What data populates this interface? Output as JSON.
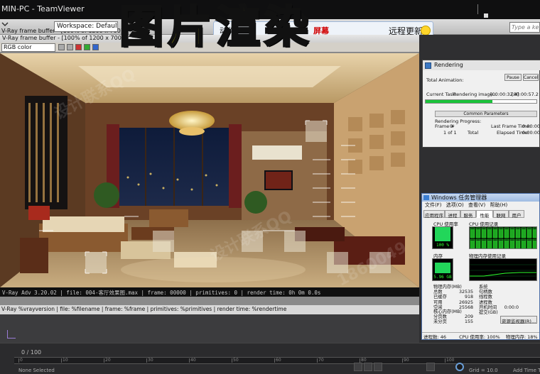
{
  "teamviewer": {
    "title": "MIN-PC - TeamViewer"
  },
  "banner": {
    "text": "图片渲染"
  },
  "max_toolbar": {
    "vfb_title": "V-Ray frame buffer - [100% of 1200 x 700]",
    "workspace_label": "Workspace: Default",
    "search_placeholder": "Type a keyword"
  },
  "chat": {
    "action": "动作",
    "screen_label": "屏幕",
    "remote_update": "远程更新"
  },
  "vfb": {
    "channel": "RGB color",
    "status_line": "V-Ray Adv 3.20.02 | file: 004-客厅效果图.max | frame: 00000 | primitives: 0 | render time: 0h 0m 0.0s"
  },
  "max": {
    "prompt_line": "V-Ray %vrayversion | file: %filename | frame: %frame | primitives: %primitives | render time: %rendertime",
    "frame_counter": "0 / 100",
    "status_selection": "None Selected",
    "grid_label": "Grid = 10.0",
    "add_key": "Add Time Tag",
    "timeline_ticks": [
      "0",
      "10",
      "20",
      "30",
      "40",
      "50",
      "60",
      "70",
      "80",
      "90",
      "100"
    ]
  },
  "rendering": {
    "title": "Rendering",
    "total_animation": "Total Animation:",
    "pause": "Pause",
    "cancel": "Cancel",
    "current_task_label": "Current Task:",
    "current_task_value": "Rendering image...",
    "elapsed_current": "[00:00:32.4]",
    "estimate_current": "[00:00:57.2 est]",
    "progress": 0.6,
    "section_title": "Common Parameters",
    "rendering_progress": "Rendering Progress:",
    "frame_label": "Frame #",
    "frame_value": "0",
    "of_label": "1 of 1",
    "total_label": "Total",
    "last_frame_time_label": "Last Frame Time:",
    "last_frame_time_value": "0:00:00",
    "elapsed_time_label": "Elapsed Time:",
    "elapsed_time_value": "0:00:00"
  },
  "task_manager": {
    "title": "Windows 任务管理器",
    "menu": [
      "文件(F)",
      "选项(O)",
      "查看(V)",
      "帮助(H)"
    ],
    "tabs": [
      "应用程序",
      "进程",
      "服务",
      "性能",
      "联网",
      "用户"
    ],
    "active_tab": 3,
    "cpu_usage_label": "CPU 使用率",
    "cpu_usage_value": "100 %",
    "cpu_usage": 1.0,
    "cpu_history_label": "CPU 使用记录",
    "memory_label": "内存",
    "memory_value": "5.96 GB",
    "memory_usage": 0.75,
    "memory_history_label": "物理内存使用记录",
    "phys_mem": {
      "title": "物理内存(MB)",
      "rows": [
        [
          "总数",
          "32535"
        ],
        [
          "已缓存",
          "918"
        ],
        [
          "可用",
          "26925"
        ],
        [
          "空闲",
          "25568"
        ]
      ]
    },
    "system": {
      "title": "系统",
      "rows": [
        [
          "句柄数",
          ""
        ],
        [
          "线程数",
          ""
        ],
        [
          "进程数",
          ""
        ],
        [
          "开机时间",
          "0:00:0"
        ],
        [
          "提交(GB)",
          ""
        ]
      ]
    },
    "kernel_mem": {
      "title": "核心内存(MB)",
      "rows": [
        [
          "分页数",
          "209"
        ],
        [
          "未分页",
          "155"
        ]
      ]
    },
    "resource_monitor": "资源监视器(R)...",
    "status": {
      "processes": "进程数: 46",
      "cpu": "CPU 使用率: 100%",
      "memory": "物理内存: 18%"
    }
  },
  "watermarks": [
    "设计联系QQ",
    "1860049"
  ]
}
